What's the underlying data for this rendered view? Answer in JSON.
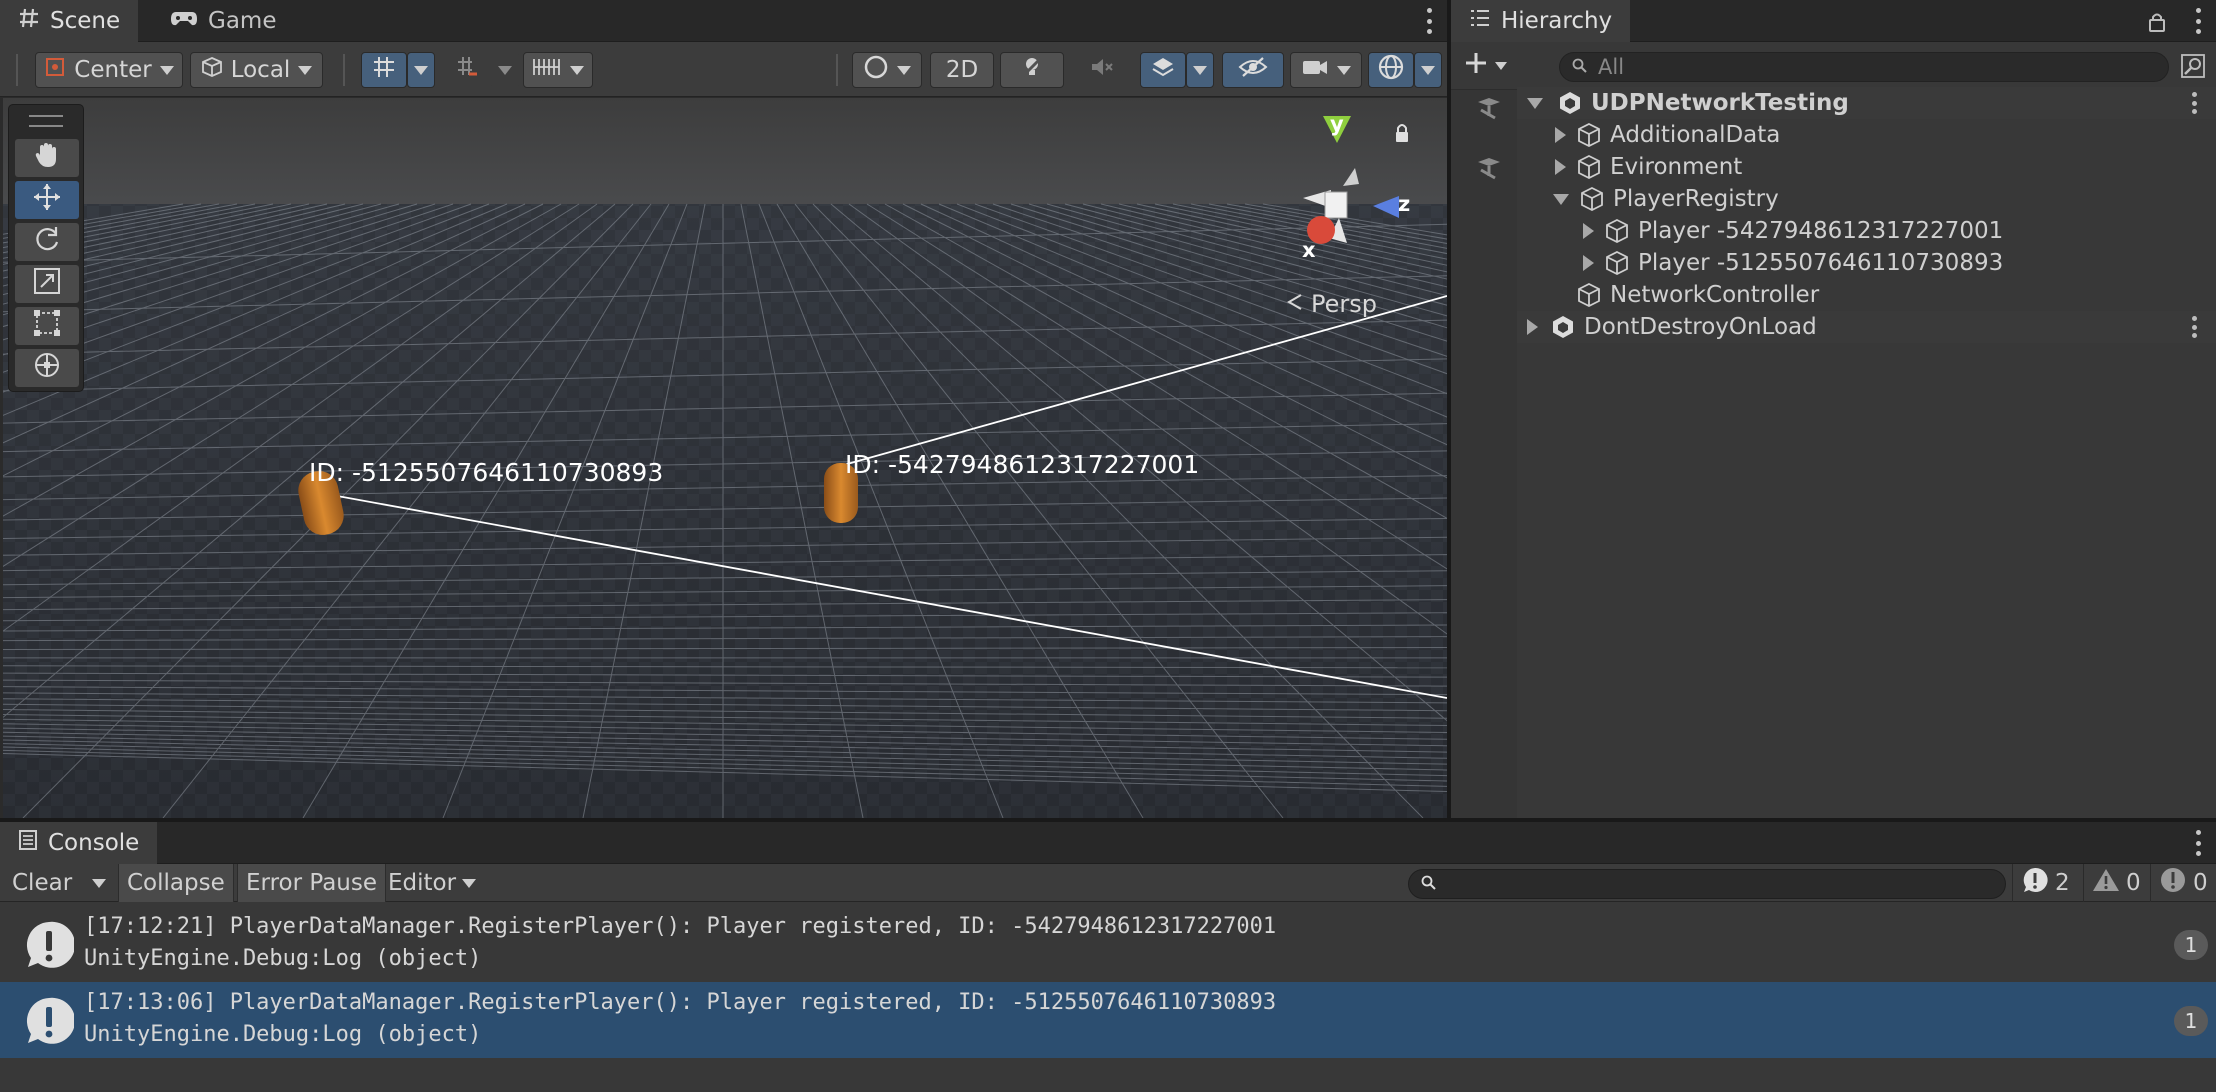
{
  "scene_panel": {
    "tabs": [
      {
        "label": "Scene",
        "icon": "grid-hash-icon"
      },
      {
        "label": "Game",
        "icon": "gamepad-icon"
      }
    ],
    "toolbar": {
      "pivot_label": "Center",
      "space_label": "Local",
      "mode_2d_label": "2D"
    },
    "tools": [
      "hand-tool",
      "move-tool",
      "rotate-tool",
      "scale-tool",
      "rect-tool",
      "transform-tool"
    ],
    "objects": [
      {
        "label": "ID: -5125507646110730893"
      },
      {
        "label": "ID: -5427948612317227001"
      }
    ],
    "gizmo": {
      "y": "y",
      "z": "z",
      "x": "x"
    },
    "projection_label": "Persp"
  },
  "hierarchy_panel": {
    "title": "Hierarchy",
    "search_placeholder": "All",
    "rows": [
      {
        "label": "UDPNetworkTesting",
        "bold": true
      },
      {
        "label": "AdditionalData"
      },
      {
        "label": "Evironment"
      },
      {
        "label": "PlayerRegistry"
      },
      {
        "label": "Player -5427948612317227001"
      },
      {
        "label": "Player -5125507646110730893"
      },
      {
        "label": "NetworkController"
      },
      {
        "label": "DontDestroyOnLoad"
      }
    ]
  },
  "console_panel": {
    "title": "Console",
    "toolbar": {
      "clear_label": "Clear",
      "collapse_label": "Collapse",
      "error_pause_label": "Error Pause",
      "editor_label": "Editor"
    },
    "counts": {
      "info": "2",
      "warning": "0",
      "error": "0"
    },
    "logs": [
      {
        "line1": "[17:12:21] PlayerDataManager.RegisterPlayer(): Player registered, ID: -5427948612317227001",
        "line2": "UnityEngine.Debug:Log (object)",
        "count": "1",
        "selected": false
      },
      {
        "line1": "[17:13:06] PlayerDataManager.RegisterPlayer(): Player registered, ID: -5125507646110730893",
        "line2": "UnityEngine.Debug:Log (object)",
        "count": "1",
        "selected": true
      }
    ]
  },
  "colors": {
    "accent_selected": "#2c4e70",
    "toggle_on": "#46607c",
    "capsule": "#d07a2a"
  }
}
